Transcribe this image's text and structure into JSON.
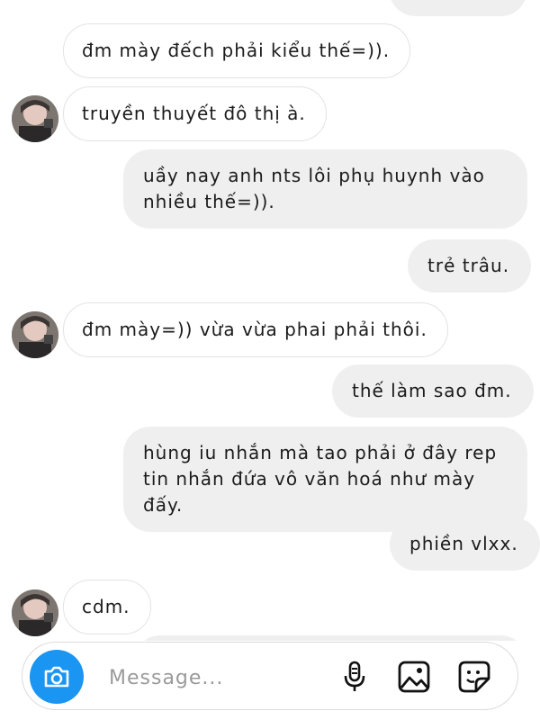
{
  "messages": [
    {
      "from": "me",
      "text": ""
    },
    {
      "from": "them",
      "text": "đm mày đếch phải kiểu thế=))."
    },
    {
      "from": "them",
      "text": "truyền thuyết đô thị à."
    },
    {
      "from": "me",
      "text": "uầy nay anh nts lôi phụ huynh vào\nnhiều thế=))."
    },
    {
      "from": "me",
      "text": "trẻ trâu."
    },
    {
      "from": "them",
      "text": "đm mày=)) vừa vừa phai phải thôi."
    },
    {
      "from": "me",
      "text": "thế làm sao đm."
    },
    {
      "from": "me",
      "text": "hùng iu nhắn mà tao phải ở đây rep\ntin nhắn đứa vô văn hoá như mày đấy."
    },
    {
      "from": "me",
      "text": "phiền vlxx."
    },
    {
      "from": "them",
      "text": "cdm."
    }
  ],
  "composer": {
    "placeholder": "Message...",
    "camera_icon": "camera-icon",
    "mic_icon": "microphone-icon",
    "gallery_icon": "image-icon",
    "sticker_icon": "sticker-icon",
    "accent_color": "#1a95f2"
  }
}
